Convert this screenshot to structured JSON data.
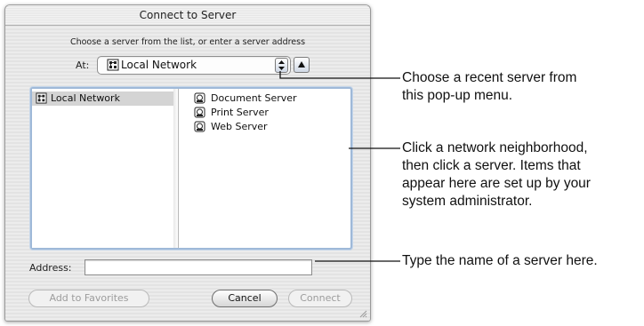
{
  "dialog": {
    "title": "Connect to Server",
    "prompt": "Choose a server from the list, or enter a server address",
    "at_label": "At:",
    "at_value": "Local Network",
    "popup_arrows_icon": "updown-arrows-icon",
    "eject_icon": "triangle-up-icon"
  },
  "browser": {
    "column1": [
      {
        "label": "Local Network",
        "icon": "network-icon",
        "selected": true
      }
    ],
    "column2": [
      {
        "label": "Document Server",
        "icon": "server-icon"
      },
      {
        "label": "Print Server",
        "icon": "server-icon"
      },
      {
        "label": "Web Server",
        "icon": "server-icon"
      }
    ]
  },
  "address": {
    "label": "Address:",
    "value": ""
  },
  "buttons": {
    "add_favorites": "Add to Favorites",
    "cancel": "Cancel",
    "connect": "Connect"
  },
  "callouts": [
    {
      "lines": [
        "Choose a recent server from",
        "this pop-up menu."
      ]
    },
    {
      "lines": [
        "Click a network neighborhood,",
        "then click a server. Items that",
        "appear here are set up by your",
        "system administrator."
      ]
    },
    {
      "lines": [
        "Type the name of a server here."
      ]
    }
  ]
}
